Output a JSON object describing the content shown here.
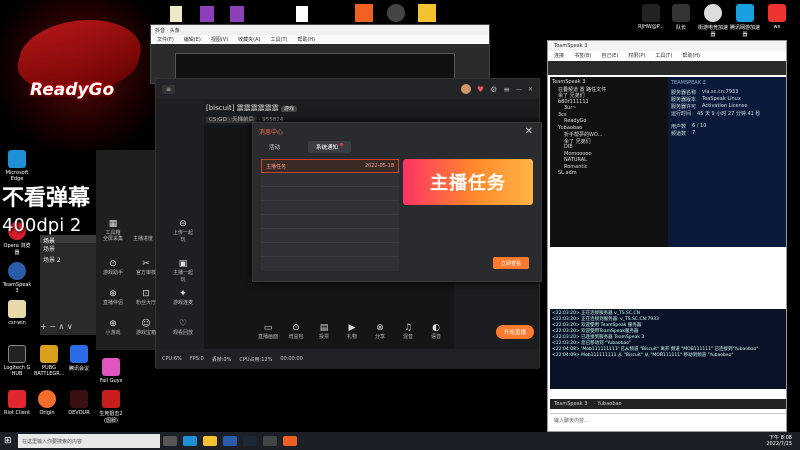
{
  "desktop": {
    "logo_text": "ReadyGo",
    "left_icons": [
      "Microsoft Edge",
      "Opera 浏览器",
      "TeamSpeak 3",
      "csr-win",
      "Logitech G HUB",
      "PUBG BATTLEGR...",
      "Riot Client",
      "Origin",
      "DEVOUR",
      "生死狙击2 (国服)"
    ],
    "right_icons": [
      "腾讯QQ",
      "腾讯会议",
      "Fall Guys"
    ],
    "top_right_icons": [
      "RJHW@P...",
      "队长",
      "街游电竞加速器",
      "腾讯网游加速器",
      "wx"
    ]
  },
  "overlay": {
    "line1": "不看弹幕",
    "line2": "400dpi 2"
  },
  "browser": {
    "title": "抖音 · 头条",
    "menu": [
      "文件(F)",
      "编辑(E)",
      "视图(V)",
      "收藏夹(A)",
      "工具(T)",
      "帮助(H)"
    ]
  },
  "obs": {
    "sources": [
      "场景",
      "场景 2"
    ],
    "header": "场景"
  },
  "app": {
    "title": "[biscuit] 震震震震震震",
    "badge": "游戏",
    "category": "CS:GO · 天梯前后",
    "viewers": "955824",
    "tools": [
      "工具箱",
      "全屏采集",
      "主播进度",
      "上传一起玩",
      "游戏助手",
      "官方审核",
      "主播一起玩",
      "直播伴侣",
      "粉丝大厅",
      "游戏连麦",
      "小游戏",
      "游戏宝箱",
      "观看回放",
      "福利",
      "推荐直播"
    ],
    "bottom_tools": [
      "直播画面",
      "增益包",
      "投票",
      "礼物",
      "分享",
      "混音",
      "语音"
    ],
    "live_label": "开始直播",
    "status": [
      "CPU:6%",
      "FPS:0",
      "丢帧:0%",
      "CPU占用:12%",
      "00:00:00"
    ]
  },
  "modal": {
    "title": "消息中心",
    "tabs": [
      "活动",
      "系统通知"
    ],
    "messages": [
      {
        "title": "主播任务",
        "date": "2022-05-18"
      },
      {
        "title": "",
        "date": ""
      },
      {
        "title": "",
        "date": ""
      },
      {
        "title": "",
        "date": ""
      },
      {
        "title": "",
        "date": ""
      },
      {
        "title": "",
        "date": ""
      },
      {
        "title": "",
        "date": ""
      },
      {
        "title": "",
        "date": ""
      }
    ],
    "banner": "主播任务",
    "claim_label": "立即查看"
  },
  "teamspeak": {
    "title": "TeamSpeak 3",
    "menu": [
      "连接",
      "书签(B)",
      "自己(E)",
      "权限(P)",
      "工具(T)",
      "帮助(H)"
    ],
    "tree": [
      "TeamSpeak 3",
      "在叠频道 置 路任文件",
      "余了 兄弟们",
      "b80r111111",
      "3ur~",
      "3cs",
      "ReadyGo",
      "Yubaobao",
      "折手帮夢的WO...",
      "余了 兄弟们",
      "DIE",
      "Momooooo",
      "NATURAL",
      "Romantic",
      "SL adm"
    ],
    "info": [
      [
        "服务器名称",
        "via.sc.cn:7933"
      ],
      [
        "服务器版本",
        "TeaSpeak Linux"
      ],
      [
        "服务器许可",
        "Activation License"
      ],
      [
        "运行时间",
        "45 天 9 小时 27 分钟 41 秒"
      ],
      [
        "用户数",
        "6 / 10"
      ],
      [
        "频道数",
        "7"
      ]
    ],
    "info_title": "TEAMSPEAK 3",
    "log": [
      "<22:03:20> 正在连接服务器 v_TS.SC.CN",
      "<22:03:20> 正在连接到服务器: v_TS.SC.CN:7933",
      "<22:03:20> 欢迎使用 TeamSpeak 服务器",
      "<22:03:20> 欢迎使用TeamSpeak服务器",
      "<22:03:20> 已连接到服务器 TeamSpeak 3",
      "<22:03:20> 您已移动到 \"Yubaobao\"",
      "<22:04:08> 'Mob111111111' 已从频道 \"Biscuit\" 离开 频道 \"MOB111111\" 已连接到\"Yubaobao\"",
      "<22:04:09> Mob111111111 从 \"Biscuit\" 从 \"MOB111111\" 移动到频道 \"Yubaobao\""
    ],
    "tabs": [
      "TeamSpeak 3",
      "Yubaobao"
    ],
    "input_placeholder": "输入聊天内容..."
  },
  "taskbar": {
    "search_placeholder": "在这里输入你要搜索的内容",
    "time": "下午 8:08",
    "date": "2022/7/15"
  },
  "colors": {
    "accent": "#ff7a2f",
    "modal_title": "#f06a4a",
    "banner_start": "#ff3366",
    "banner_end": "#ffb347"
  }
}
